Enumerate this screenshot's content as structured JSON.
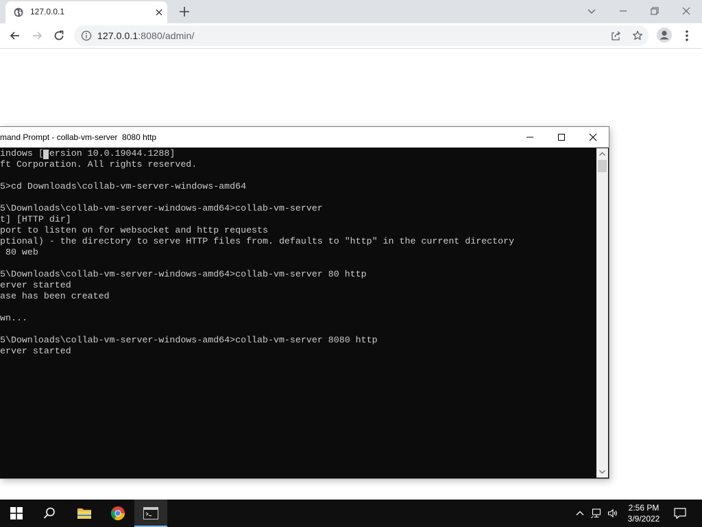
{
  "browser": {
    "tab_title": "127.0.0.1",
    "url_host": "127.0.0.1",
    "url_path": ":8080/admin/"
  },
  "cmd": {
    "title": "mand Prompt - collab-vm-server  8080 http",
    "lines": [
      "indows [Version 10.0.19044.1288]",
      "ft Corporation. All rights reserved.",
      "",
      "5>cd Downloads\\collab-vm-server-windows-amd64",
      "",
      "5\\Downloads\\collab-vm-server-windows-amd64>collab-vm-server",
      "t] [HTTP dir]",
      "port to listen on for websocket and http requests",
      "ptional) - the directory to serve HTTP files from. defaults to \"http\" in the current directory",
      " 80 web",
      "",
      "5\\Downloads\\collab-vm-server-windows-amd64>collab-vm-server 80 http",
      "erver started",
      "ase has been created",
      "",
      "wn...",
      "",
      "5\\Downloads\\collab-vm-server-windows-amd64>collab-vm-server 8080 http",
      "erver started"
    ]
  },
  "taskbar": {
    "time": "2:56 PM",
    "date": "3/9/2022"
  },
  "colors": {
    "console_bg": "#0c0c0c",
    "console_fg": "#cccccc",
    "taskbar_bg": "#0f0f0f",
    "active_underline": "#76b9ed"
  }
}
